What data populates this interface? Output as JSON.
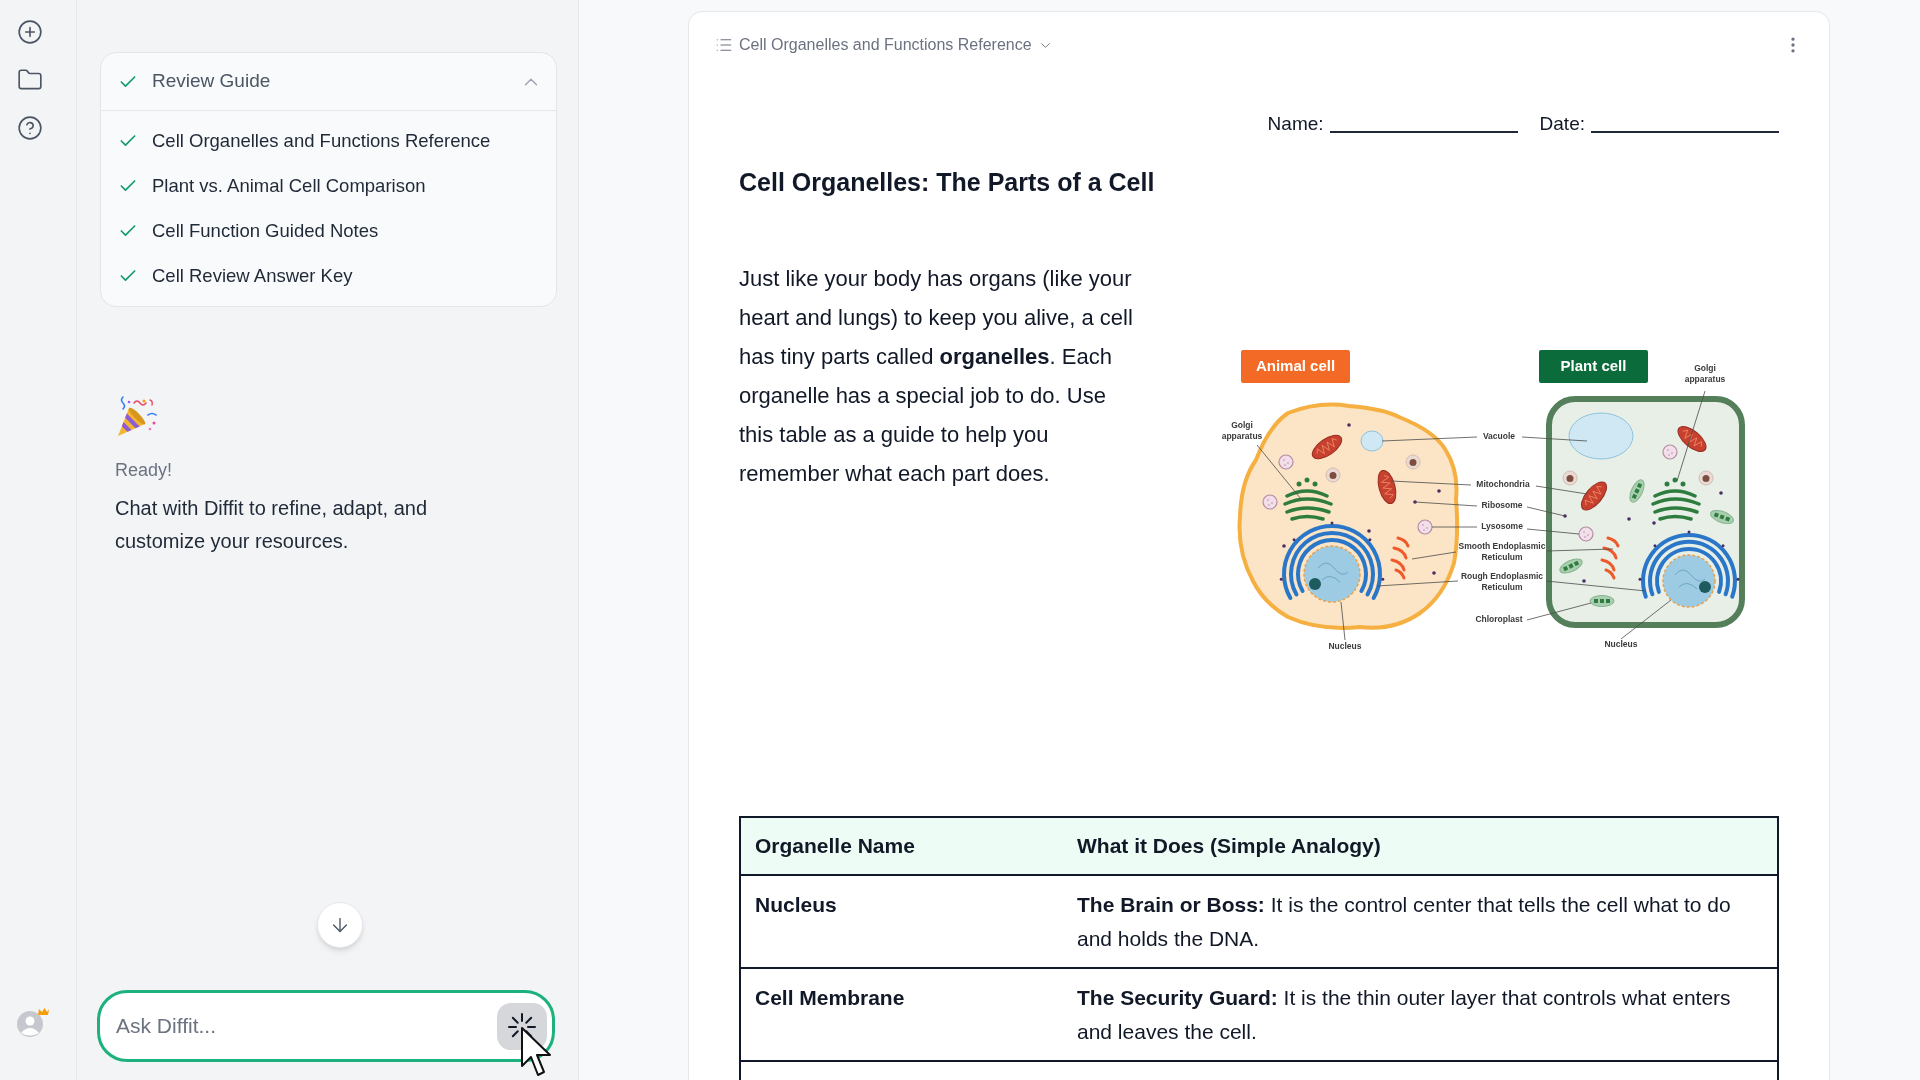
{
  "review_guide": {
    "title": "Review Guide",
    "checked": true,
    "expanded": true,
    "items": [
      {
        "label": "Cell Organelles and Functions Reference",
        "checked": true
      },
      {
        "label": "Plant vs. Animal Cell Comparison",
        "checked": true
      },
      {
        "label": "Cell Function Guided Notes",
        "checked": true
      },
      {
        "label": "Cell Review Answer Key",
        "checked": true
      }
    ]
  },
  "chat": {
    "status": "Ready!",
    "message": "Chat with Diffit to refine, adapt, and customize your resources.",
    "input": {
      "placeholder": "Ask Diffit..."
    }
  },
  "document": {
    "title": "Cell Organelles and Functions Reference",
    "fields": [
      {
        "label": "Name:"
      },
      {
        "label": "Date:"
      }
    ],
    "heading": "Cell Organelles: The Parts of a Cell",
    "intro": "Just like your body has organs (like your heart and lungs) to keep you alive, a cell has tiny parts called **organelles**. Each organelle has a special job to do. Use this table as a guide to help you remember what each part does.",
    "diagram": {
      "badges": [
        {
          "text": "Animal cell",
          "color": "#f26a25"
        },
        {
          "text": "Plant cell",
          "color": "#0b6b3a"
        }
      ],
      "labels": [
        "Golgi apparatus",
        "Vacuole",
        "Mitochondria",
        "Ribosome",
        "Lysosome",
        "Smooth Endoplasmic Reticulum",
        "Rough Endoplasmic Reticulum",
        "Chloroplast",
        "Nucleus",
        "Nucleus",
        "Golgi apparatus"
      ]
    },
    "table": {
      "columns": [
        "Organelle Name",
        "What it Does (Simple Analogy)"
      ],
      "rows": [
        {
          "name": "Nucleus",
          "description": "**The Brain or Boss:** It is the control center that tells the cell what to do and holds the DNA."
        },
        {
          "name": "Cell Membrane",
          "description": "**The Security Guard:** It is the thin outer layer that controls what enters and leaves the cell."
        }
      ]
    }
  }
}
